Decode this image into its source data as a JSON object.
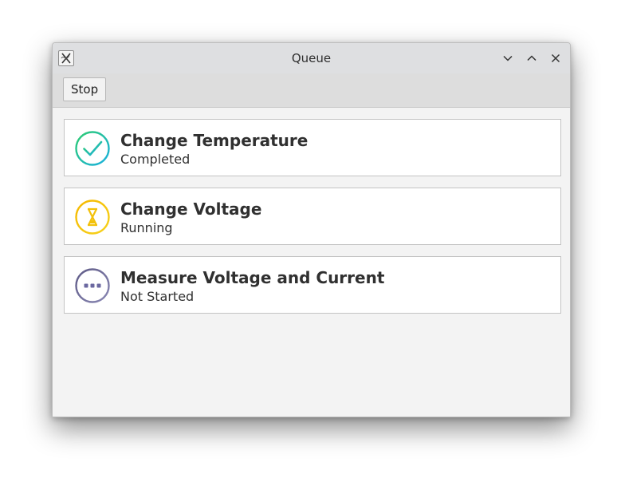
{
  "window": {
    "title": "Queue",
    "app_icon": "x-app-icon",
    "controls": [
      "minimize-chevron-down-icon",
      "maximize-chevron-up-icon",
      "close-icon"
    ]
  },
  "toolbar": {
    "stop_label": "Stop"
  },
  "tasks": [
    {
      "name": "Change Temperature",
      "status": "Completed",
      "icon": "check-circle-icon",
      "colors": [
        "#2ecc71",
        "#1ab0e0"
      ]
    },
    {
      "name": "Change Voltage",
      "status": "Running",
      "icon": "hourglass-circle-icon",
      "colors": [
        "#f5b800",
        "#f6d21c"
      ]
    },
    {
      "name": "Measure Voltage and Current",
      "status": "Not Started",
      "icon": "ellipsis-circle-icon",
      "colors": [
        "#5e5a86",
        "#8a88b4"
      ]
    }
  ]
}
